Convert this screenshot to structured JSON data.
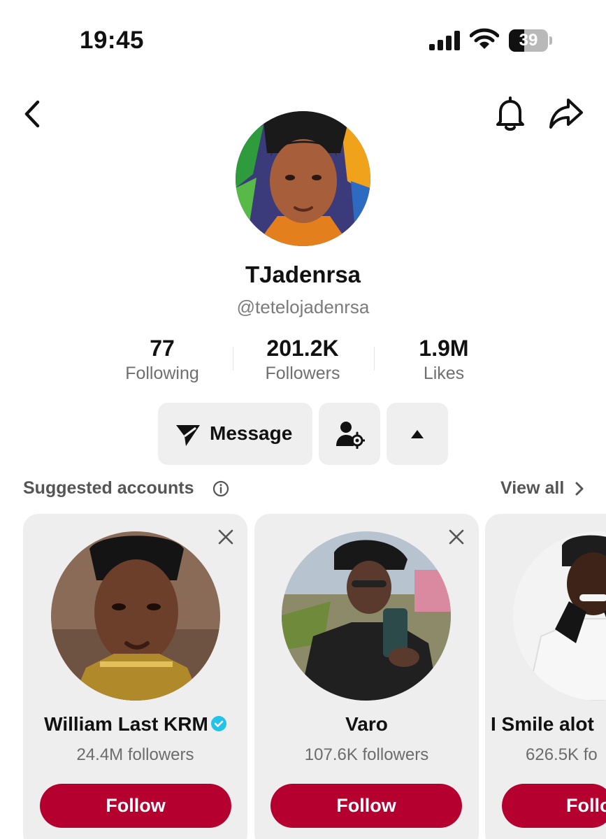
{
  "status_bar": {
    "time": "19:45",
    "battery": "39",
    "battery_level": 0.39
  },
  "profile": {
    "display_name": "TJadenrsa",
    "username": "@tetelojadenrsa",
    "stats": [
      {
        "value": "77",
        "label": "Following"
      },
      {
        "value": "201.2K",
        "label": "Followers"
      },
      {
        "value": "1.9M",
        "label": "Likes"
      }
    ]
  },
  "actions": {
    "message_label": "Message"
  },
  "suggested": {
    "title": "Suggested accounts",
    "view_all": "View all",
    "accounts": [
      {
        "name": "William Last KRM",
        "followers": "24.4M followers",
        "follow_label": "Follow",
        "verified": true
      },
      {
        "name": "Varo",
        "followers": "107.6K followers",
        "follow_label": "Follow",
        "verified": false
      },
      {
        "name": "I Smile alot",
        "followers": "626.5K fo",
        "follow_label": "Follo",
        "verified": false
      }
    ]
  },
  "colors": {
    "follow_button": "#b5002f",
    "verified": "#20c4ea",
    "secondary_text": "#6f6f6f",
    "button_bg": "#efefef"
  },
  "icons": [
    "back-chevron-icon",
    "bell-icon",
    "share-icon",
    "send-icon",
    "add-friend-icon",
    "caret-up-icon",
    "info-icon",
    "chevron-right-icon",
    "close-icon",
    "verified-badge-icon"
  ]
}
